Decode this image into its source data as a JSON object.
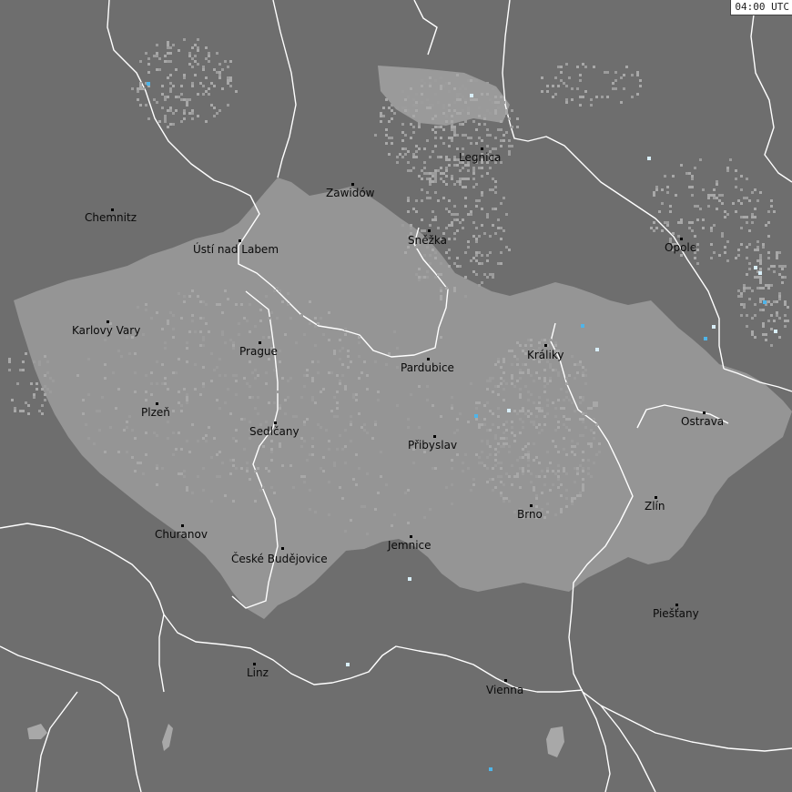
{
  "timestamp": "04:00 UTC",
  "colors": {
    "background": "#6e6e6e",
    "highlight_region": "#959595",
    "border_line": "#ffffff",
    "density_pixel": "#a8a8a8",
    "strike_cyan": "#4fb4e8",
    "text": "#0a0a0a"
  },
  "cities": [
    {
      "id": "chemnitz",
      "name": "Chemnitz"
    },
    {
      "id": "usti",
      "name": "Ústí nad Labem"
    },
    {
      "id": "zawidow",
      "name": "Zawidów"
    },
    {
      "id": "legnica",
      "name": "Legnica"
    },
    {
      "id": "snezka",
      "name": "Sněžka"
    },
    {
      "id": "opole",
      "name": "Opole"
    },
    {
      "id": "karlovy",
      "name": "Karlovy Vary"
    },
    {
      "id": "prague",
      "name": "Prague"
    },
    {
      "id": "pardubice",
      "name": "Pardubice"
    },
    {
      "id": "kraliky",
      "name": "Králiky"
    },
    {
      "id": "plzen",
      "name": "Plzeň"
    },
    {
      "id": "sedlcany",
      "name": "Sedlčany"
    },
    {
      "id": "pribyslav",
      "name": "Přibyslav"
    },
    {
      "id": "ostrava",
      "name": "Ostrava"
    },
    {
      "id": "zlin",
      "name": "Zlín"
    },
    {
      "id": "brno",
      "name": "Brno"
    },
    {
      "id": "churanov",
      "name": "Churanov"
    },
    {
      "id": "budejovice",
      "name": "České Budějovice"
    },
    {
      "id": "jemnice",
      "name": "Jemnice"
    },
    {
      "id": "piestany",
      "name": "Piešťany"
    },
    {
      "id": "linz",
      "name": "Linz"
    },
    {
      "id": "vienna",
      "name": "Vienna"
    }
  ]
}
